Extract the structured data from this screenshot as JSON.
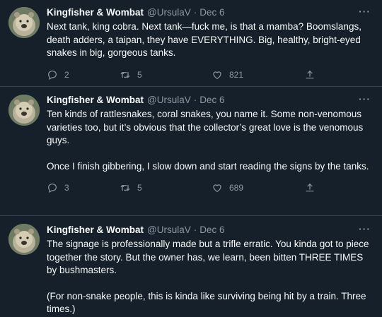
{
  "tweets": [
    {
      "author": "Kingfisher & Wombat",
      "handle": "@UrsulaV",
      "separator": "·",
      "date": "Dec 6",
      "more": "···",
      "paragraphs": [
        "Next tank, king cobra. Next tank—fuck me, is that a mamba? Boomslangs, death adders, a taipan, they have EVERYTHING. Big, healthy, bright-eyed snakes in big, gorgeous tanks."
      ],
      "replies": "2",
      "retweets": "5",
      "likes": "821"
    },
    {
      "author": "Kingfisher & Wombat",
      "handle": "@UrsulaV",
      "separator": "·",
      "date": "Dec 6",
      "more": "···",
      "paragraphs": [
        "Ten kinds of rattlesnakes, coral snakes, you name it. Some non-venomous varieties too, but it’s obvious that the collector’s great love is the venomous guys.",
        "Once I finish gibbering, I slow down and start reading the signs by the tanks."
      ],
      "replies": "3",
      "retweets": "5",
      "likes": "689"
    },
    {
      "author": "Kingfisher & Wombat",
      "handle": "@UrsulaV",
      "separator": "·",
      "date": "Dec 6",
      "more": "···",
      "paragraphs": [
        "The signage is professionally made but a trifle erratic. You kinda got to piece together the story. But the owner has, we learn, been bitten THREE TIMES by bushmasters.",
        "(For non-snake people, this is kinda like surviving being hit by a train. Three times.)"
      ]
    }
  ],
  "icons": {
    "reply": "reply-icon",
    "retweet": "retweet-icon",
    "like": "heart-icon",
    "share": "share-icon",
    "more": "more-icon"
  },
  "colors": {
    "background": "#15202b",
    "text": "#f7f9f9",
    "secondary": "#8b98a5",
    "divider": "#38444d"
  }
}
